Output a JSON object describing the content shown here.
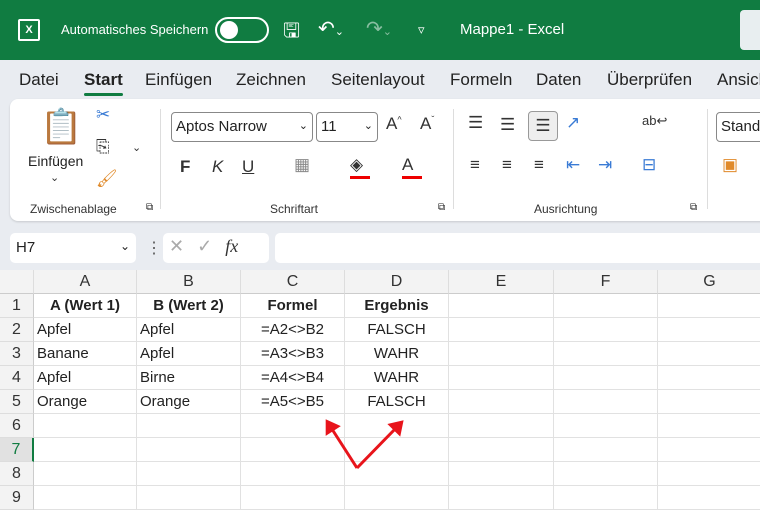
{
  "titlebar": {
    "app_icon": "excel-logo-icon",
    "autosave_label": "Automatisches Speichern",
    "autosave_on": false,
    "doc_title": "Mappe1  -  Excel"
  },
  "tabs": [
    "Datei",
    "Start",
    "Einfügen",
    "Zeichnen",
    "Seitenlayout",
    "Formeln",
    "Daten",
    "Überprüfen",
    "Ansicht"
  ],
  "active_tab": "Start",
  "ribbon": {
    "clipboard": {
      "paste_label": "Einfügen",
      "group_label": "Zwischenablage"
    },
    "font": {
      "font_name": "Aptos Narrow",
      "font_size": "11",
      "bold": "F",
      "italic": "K",
      "underline": "U",
      "font_color_letter": "A",
      "group_label": "Schriftart"
    },
    "alignment": {
      "group_label": "Ausrichtung"
    },
    "number": {
      "format": "Standard"
    }
  },
  "formula_bar": {
    "name_box": "H7",
    "fx": "fx",
    "formula": ""
  },
  "grid": {
    "columns": [
      "A",
      "B",
      "C",
      "D",
      "E",
      "F",
      "G"
    ],
    "rows": [
      "1",
      "2",
      "3",
      "4",
      "5",
      "6",
      "7",
      "8",
      "9"
    ],
    "selected_row": "7",
    "cells": [
      [
        "A (Wert 1)",
        "B (Wert 2)",
        "Formel",
        "Ergebnis"
      ],
      [
        "Apfel",
        "Apfel",
        "=A2<>B2",
        "FALSCH"
      ],
      [
        "Banane",
        "Apfel",
        "=A3<>B3",
        "WAHR"
      ],
      [
        "Apfel",
        "Birne",
        "=A4<>B4",
        "WAHR"
      ],
      [
        "Orange",
        "Orange",
        "=A5<>B5",
        "FALSCH"
      ]
    ]
  },
  "annotation": {
    "arrow_color": "#e8141b"
  },
  "colors": {
    "brand": "#107c41"
  }
}
